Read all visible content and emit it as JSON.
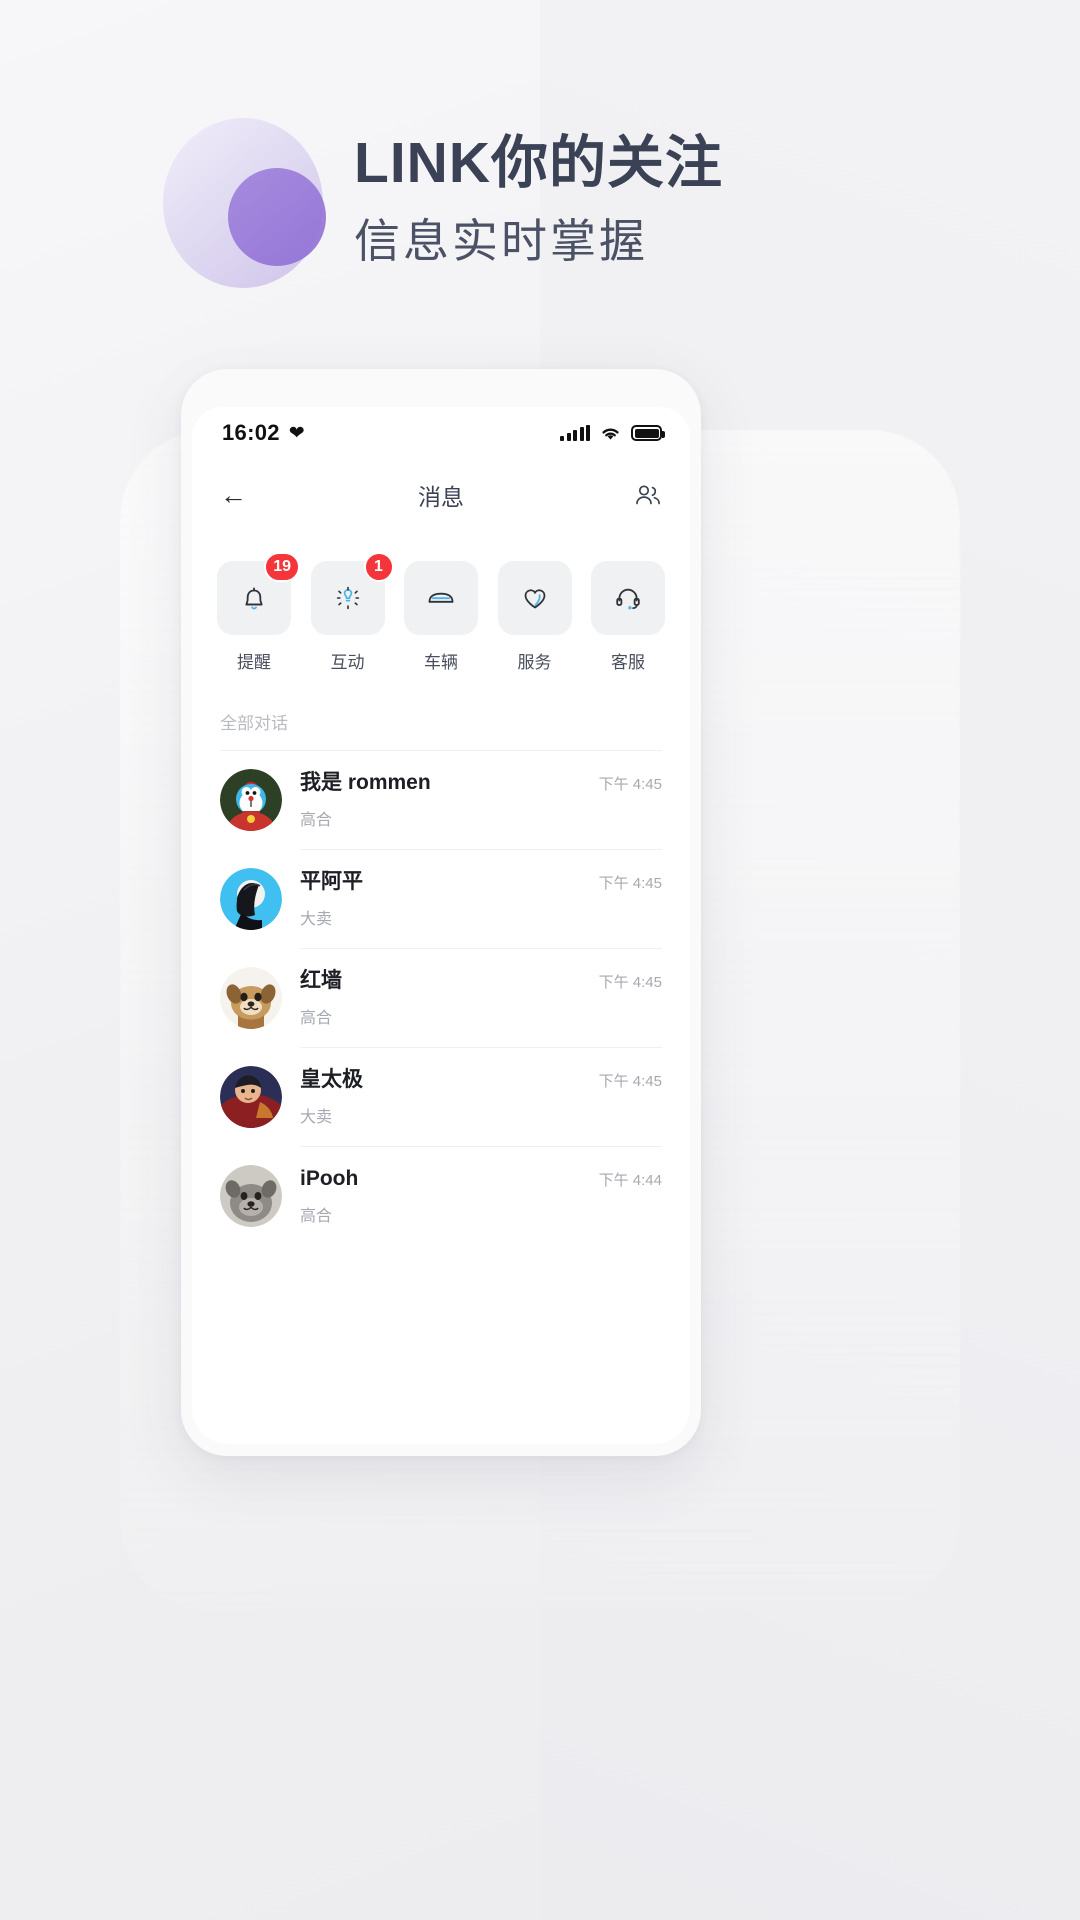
{
  "hero": {
    "title": "LINK你的关注",
    "subtitle": "信息实时掌握",
    "accent_color": "#8f6fd4",
    "title_color": "#3b4256"
  },
  "phone": {
    "status_bar": {
      "time": "16:02",
      "heart_icon": "heart-icon",
      "signal_icon": "signal-bars-icon",
      "wifi_icon": "wifi-icon",
      "battery_icon": "battery-icon"
    },
    "nav": {
      "back_icon": "back-arrow-icon",
      "title": "消息",
      "contacts_icon": "people-icon"
    },
    "tiles": [
      {
        "label": "提醒",
        "icon": "bell-icon",
        "badge": "19"
      },
      {
        "label": "互动",
        "icon": "spark-icon",
        "badge": "1"
      },
      {
        "label": "车辆",
        "icon": "car-icon",
        "badge": ""
      },
      {
        "label": "服务",
        "icon": "heart-outline-icon",
        "badge": ""
      },
      {
        "label": "客服",
        "icon": "headset-icon",
        "badge": ""
      }
    ],
    "section": {
      "title": "全部对话"
    },
    "chats": [
      {
        "name": "我是 rommen",
        "preview": "高合",
        "time": "下午 4:45",
        "avatar": "doraemon-avatar"
      },
      {
        "name": "平阿平",
        "preview": "大卖",
        "time": "下午 4:45",
        "avatar": "blue-portrait-avatar"
      },
      {
        "name": "红墙",
        "preview": "高合",
        "time": "下午 4:45",
        "avatar": "dog-avatar"
      },
      {
        "name": "皇太极",
        "preview": "大卖",
        "time": "下午 4:45",
        "avatar": "red-portrait-avatar"
      },
      {
        "name": "iPooh",
        "preview": "高合",
        "time": "下午 4:44",
        "avatar": "grey-dog-avatar"
      }
    ]
  },
  "theme": {
    "badge_red": "#f4353a",
    "tile_bg": "#f0f1f3",
    "icon_accent": "#4ab6e8",
    "page_bg": "#f2f2f4"
  }
}
